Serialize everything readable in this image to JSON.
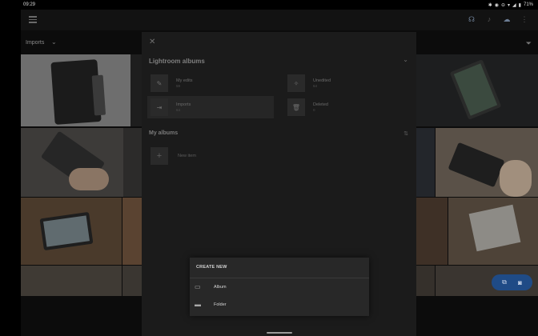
{
  "status_bar": {
    "time": "09:29",
    "battery": "71%",
    "icons": [
      "bluetooth-icon",
      "eye-icon",
      "dnd-icon",
      "wifi-icon",
      "signal-icon",
      "battery-icon"
    ]
  },
  "toolbar": {
    "icons": [
      "menu-icon",
      "headset-icon",
      "bell-icon",
      "cloud-icon",
      "more-icon"
    ]
  },
  "subbar": {
    "folder_label": "Imports"
  },
  "panel": {
    "lightroom_title": "Lightroom albums",
    "albums": [
      {
        "name": "My edits",
        "count": "59"
      },
      {
        "name": "Unedited",
        "count": "64"
      },
      {
        "name": "Imports",
        "count": "64"
      },
      {
        "name": "Deleted",
        "count": "0"
      }
    ],
    "my_albums_title": "My albums",
    "new_item_label": "New item"
  },
  "create_sheet": {
    "title": "CREATE NEW",
    "items": [
      {
        "label": "Album",
        "icon": "album-icon"
      },
      {
        "label": "Folder",
        "icon": "folder-icon"
      }
    ]
  },
  "colors": {
    "accent": "#1f4b86",
    "panel_bg": "#1b1b1b",
    "sheet_bg": "#282828"
  }
}
